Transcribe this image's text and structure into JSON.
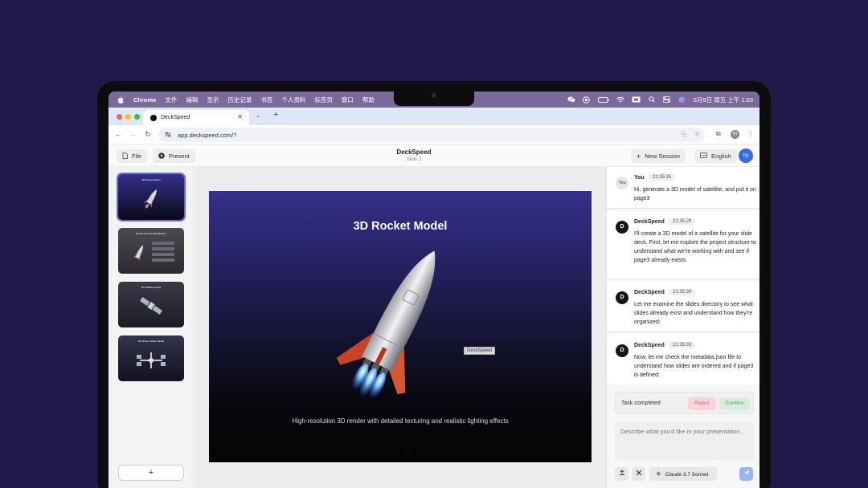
{
  "menubar": {
    "items": [
      "Chrome",
      "文件",
      "编辑",
      "显示",
      "历史记录",
      "书签",
      "个人资料",
      "标签页",
      "窗口",
      "帮助"
    ],
    "clock": "5月9日 周五 上午 1:03"
  },
  "browser": {
    "tab_title": "DeckSpeed",
    "url": "app.deckspeed.com/?",
    "profile_initial": "m"
  },
  "header": {
    "file_label": "File",
    "present_label": "Present",
    "title": "DeckSpeed",
    "subtitle": "Slide 2",
    "new_session_label": "New Session",
    "language_label": "English",
    "avatar_initials": "hy"
  },
  "sidebar": {
    "thumbnails": [
      {
        "title": "3D Rocket Model"
      },
      {
        "title": "Rocket Structure Breakdown"
      },
      {
        "title": "3D Satellite Model"
      },
      {
        "title": "3D Space Station Model"
      }
    ],
    "add_label": "+"
  },
  "slide": {
    "title": "3D Rocket Model",
    "caption": "High-resolution 3D render with detailed texturing and realistic lighting effects",
    "chip_label": "DeckSpeed"
  },
  "chat": {
    "messages": [
      {
        "author": "You",
        "avatar": "You",
        "time": "21:35:25",
        "text": "Hi, generate a 3D model of satellite, and put it on page3"
      },
      {
        "author": "DeckSpeed",
        "avatar": "D",
        "time": "21:35:28",
        "text": "I'll create a 3D model of a satellite for your slide deck. First, let me explore the project structure to understand what we're working with and see if page3 already exists."
      },
      {
        "author": "DeckSpeed",
        "avatar": "D",
        "time": "21:35:30",
        "text": "Let me examine the slides directory to see what slides already exist and understand how they're organized:"
      },
      {
        "author": "DeckSpeed",
        "avatar": "D",
        "time": "21:35:33",
        "text": "Now, let me check the metadata.json file to understand how slides are ordered and if page3 is defined:"
      }
    ],
    "task_status": "Task completed",
    "reject_label": "Reject",
    "confirm_label": "Confirm",
    "input_placeholder": "Describe what you'd like in your presentation...",
    "model_label": "Claude 3.7 Sonnet"
  }
}
